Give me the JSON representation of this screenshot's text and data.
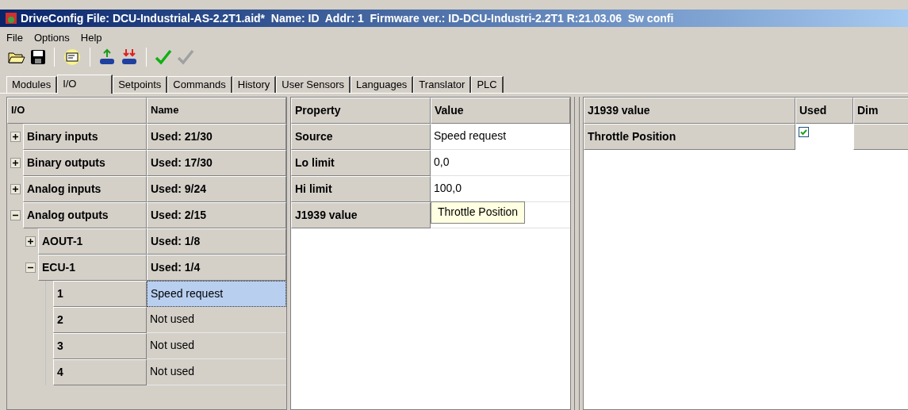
{
  "window": {
    "title": "DriveConfig File: DCU-Industrial-AS-2.2T1.aid*  Name: ID  Addr: 1  Firmware ver.: ID-DCU-Industri-2.2T1 R:21.03.06  Sw confi"
  },
  "menu": [
    "File",
    "Options",
    "Help"
  ],
  "toolbar": [
    {
      "kind": "open",
      "disabled": false
    },
    {
      "kind": "save",
      "disabled": false
    },
    {
      "kind": "separator"
    },
    {
      "kind": "properties",
      "disabled": false
    },
    {
      "kind": "separator"
    },
    {
      "kind": "upload",
      "disabled": false
    },
    {
      "kind": "download",
      "disabled": false
    },
    {
      "kind": "separator"
    },
    {
      "kind": "check",
      "disabled": false
    },
    {
      "kind": "check",
      "disabled": true
    }
  ],
  "tabs": [
    {
      "label": "Modules",
      "selected": false
    },
    {
      "label": "I/O",
      "selected": true
    },
    {
      "label": "Setpoints",
      "selected": false
    },
    {
      "label": "Commands",
      "selected": false
    },
    {
      "label": "History",
      "selected": false
    },
    {
      "label": "User Sensors",
      "selected": false
    },
    {
      "label": "Languages",
      "selected": false
    },
    {
      "label": "Translator",
      "selected": false
    },
    {
      "label": "PLC",
      "selected": false
    }
  ],
  "io_tree": {
    "columns": [
      "I/O",
      "Name"
    ],
    "items": [
      {
        "label": "Binary inputs",
        "name": "Used: 21/30",
        "expanded": false
      },
      {
        "label": "Binary outputs",
        "name": "Used: 17/30",
        "expanded": false
      },
      {
        "label": "Analog inputs",
        "name": "Used: 9/24",
        "expanded": false
      },
      {
        "label": "Analog outputs",
        "name": "Used: 2/15",
        "expanded": true,
        "children": [
          {
            "label": "AOUT-1",
            "name": "Used: 1/8",
            "expanded": false
          },
          {
            "label": "ECU-1",
            "name": "Used: 1/4",
            "expanded": true,
            "children": [
              {
                "label": "1",
                "name": "Speed request",
                "selected": true
              },
              {
                "label": "2",
                "name": "Not used",
                "selected": false
              },
              {
                "label": "3",
                "name": "Not used",
                "selected": false
              },
              {
                "label": "4",
                "name": "Not used",
                "selected": false
              }
            ]
          }
        ]
      }
    ]
  },
  "properties": {
    "columns": [
      "Property",
      "Value"
    ],
    "rows": [
      {
        "property": "Source",
        "value": "Speed request",
        "editing": false
      },
      {
        "property": "Lo limit",
        "value": "0,0",
        "editing": false
      },
      {
        "property": "Hi limit",
        "value": "100,0",
        "editing": false
      },
      {
        "property": "J1939 value",
        "value": "Throttle Position",
        "editing": true
      }
    ]
  },
  "j1939": {
    "columns": [
      "J1939 value",
      "Used",
      "Dim"
    ],
    "rows": [
      {
        "value": "Throttle Position",
        "used": true
      }
    ]
  }
}
